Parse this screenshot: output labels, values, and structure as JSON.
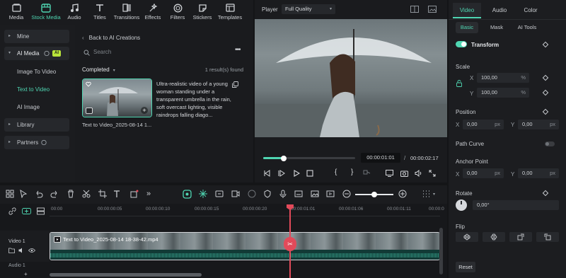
{
  "toolbar": {
    "tabs": [
      {
        "label": "Media",
        "icon": "media-icon"
      },
      {
        "label": "Stock Media",
        "icon": "stock-media-icon"
      },
      {
        "label": "Audio",
        "icon": "audio-icon"
      },
      {
        "label": "Titles",
        "icon": "titles-icon"
      },
      {
        "label": "Transitions",
        "icon": "transitions-icon"
      },
      {
        "label": "Effects",
        "icon": "effects-icon"
      },
      {
        "label": "Filters",
        "icon": "filters-icon"
      },
      {
        "label": "Stickers",
        "icon": "stickers-icon"
      },
      {
        "label": "Templates",
        "icon": "templates-icon"
      }
    ]
  },
  "sidebar": {
    "mine": "Mine",
    "ai_media": "AI Media",
    "ai_badge": "AI",
    "image_to_video": "Image To Video",
    "text_to_video": "Text to Video",
    "ai_image": "AI Image",
    "library": "Library",
    "partners": "Partners"
  },
  "media": {
    "back_label": "Back to AI Creations",
    "search_placeholder": "Search",
    "filter_label": "Completed",
    "result_count": "1 result(s) found",
    "item_description": "Ultra-realistic video of a young woman standing under a transparent umbrella in the rain, soft overcast lighting, visible raindrops falling diago...",
    "item_name": "Text to Video_2025-08-14 1..."
  },
  "player": {
    "label": "Player",
    "quality": "Full Quality",
    "current_time": "00:00:01:01",
    "separator": "/",
    "total_time": "00:00:02:17",
    "progress": 0.22
  },
  "inspector": {
    "tabs": [
      "Video",
      "Audio",
      "Color"
    ],
    "subtabs": [
      "Basic",
      "Mask",
      "AI Tools"
    ],
    "transform_label": "Transform",
    "scale_label": "Scale",
    "scale_x": "100,00",
    "scale_y": "100,00",
    "percent": "%",
    "position_label": "Position",
    "pos_x": "0,00",
    "pos_y": "0,00",
    "px": "px",
    "path_curve_label": "Path Curve",
    "anchor_label": "Anchor Point",
    "anchor_x": "0,00",
    "anchor_y": "0,00",
    "rotate_label": "Rotate",
    "rotate_value": "0,00°",
    "flip_label": "Flip",
    "reset_label": "Reset",
    "x": "X",
    "y": "Y"
  },
  "timeline": {
    "ruler": [
      "00:00",
      "00:00:00:05",
      "00:00:00:10",
      "00:00:00:15",
      "00:00:00:20",
      "00:00:01:01",
      "00:00:01:06",
      "00:00:01:11",
      "00:00:0"
    ],
    "video_track": "Video 1",
    "audio_track": "Audio 1",
    "clip_title": "Text to Video_2025-08-14 18-38-42.mp4"
  },
  "colors": {
    "accent": "#4fd6b2",
    "playhead": "#e24a5a",
    "badge": "#b9e43a"
  }
}
